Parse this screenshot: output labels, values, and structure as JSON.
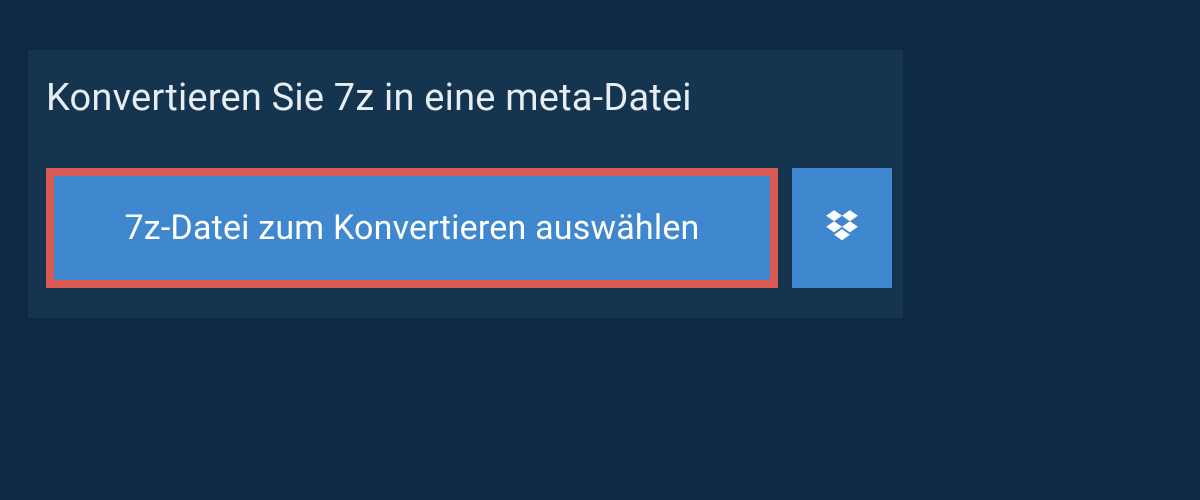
{
  "heading": "Konvertieren Sie 7z in eine meta-Datei",
  "select_button_label": "7z-Datei zum Konvertieren auswählen"
}
